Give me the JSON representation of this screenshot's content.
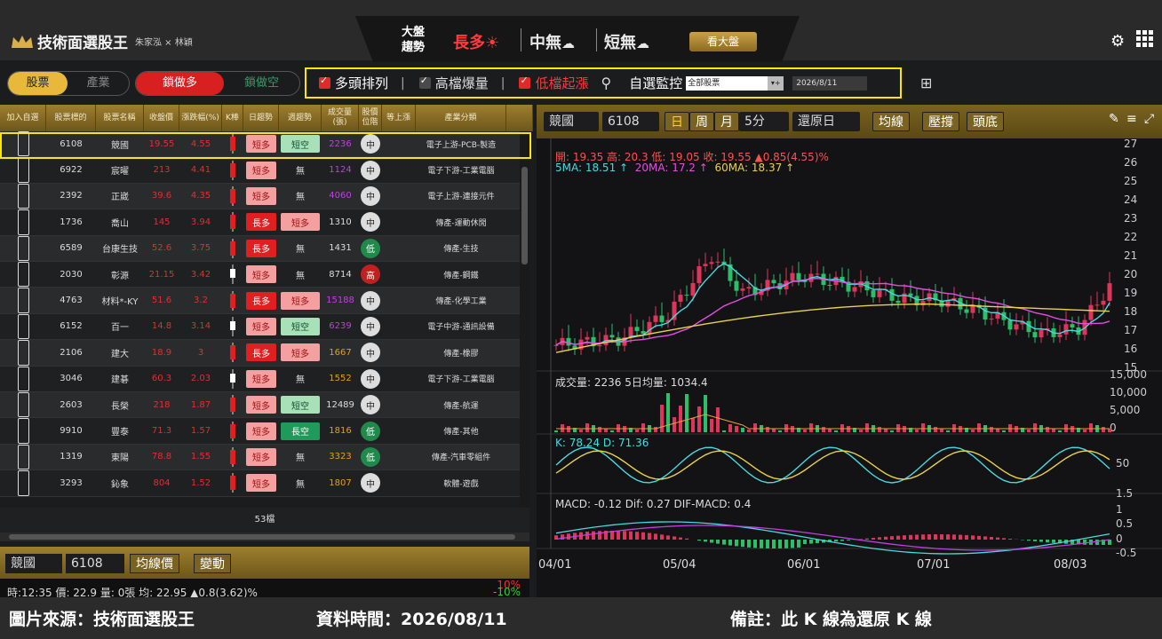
{
  "app": {
    "title": "技術面選股王",
    "authors": "朱家泓 × 林穎"
  },
  "market": {
    "label1": "大盤",
    "label2": "趨勢",
    "long": "長多",
    "mid": "中無",
    "short": "短無",
    "btn": "看大盤"
  },
  "tabs": {
    "stock": "股票",
    "industry": "產業",
    "lock_long": "鎖做多",
    "lock_short": "鎖做空"
  },
  "filters": {
    "f1": "多頭排列",
    "f2": "高檔爆量",
    "f3": "低檔起漲",
    "watch": "自選監控",
    "select": "全部股票",
    "date": "2026/8/11"
  },
  "columns": [
    "加入自選",
    "股票標的",
    "股票名稱",
    "收盤價",
    "漲跌幅(%)",
    "K棒",
    "日趨勢",
    "週趨勢",
    "成交量(張)",
    "股價位階",
    "等上漲",
    "產業分類"
  ],
  "rows": [
    {
      "code": "6108",
      "name": "競國",
      "price": "19.55",
      "chg": "4.55",
      "day": "短多",
      "week": "短空",
      "vol": "2236",
      "pos": "中",
      "ind": "電子上游-PCB-製造",
      "candle": "r"
    },
    {
      "code": "6922",
      "name": "宸曜",
      "price": "213",
      "chg": "4.41",
      "day": "短多",
      "week": "無",
      "vol": "1124",
      "pos": "中",
      "ind": "電子下游-工業電腦",
      "candle": "r"
    },
    {
      "code": "2392",
      "name": "正崴",
      "price": "39.6",
      "chg": "4.35",
      "day": "短多",
      "week": "無",
      "vol": "4060",
      "pos": "中",
      "ind": "電子上游-連接元件",
      "candle": "r"
    },
    {
      "code": "1736",
      "name": "喬山",
      "price": "145",
      "chg": "3.94",
      "day": "長多",
      "week": "短多",
      "vol": "1310",
      "pos": "中",
      "ind": "傳產-運動休閒",
      "candle": "r"
    },
    {
      "code": "6589",
      "name": "台康生技",
      "price": "52.6",
      "chg": "3.75",
      "day": "長多",
      "week": "無",
      "vol": "1431",
      "pos": "低",
      "ind": "傳產-生技",
      "candle": "r"
    },
    {
      "code": "2030",
      "name": "彰源",
      "price": "21.15",
      "chg": "3.42",
      "day": "短多",
      "week": "無",
      "vol": "8714",
      "pos": "高",
      "ind": "傳產-鋼鐵",
      "candle": "w"
    },
    {
      "code": "4763",
      "name": "材料*-KY",
      "price": "51.6",
      "chg": "3.2",
      "day": "長多",
      "week": "短多",
      "vol": "15188",
      "pos": "中",
      "ind": "傳產-化學工業",
      "candle": "r"
    },
    {
      "code": "6152",
      "name": "百一",
      "price": "14.8",
      "chg": "3.14",
      "day": "短多",
      "week": "短空",
      "vol": "6239",
      "pos": "中",
      "ind": "電子中游-通訊設備",
      "candle": "w"
    },
    {
      "code": "2106",
      "name": "建大",
      "price": "18.9",
      "chg": "3",
      "day": "長多",
      "week": "短多",
      "vol": "1667",
      "pos": "中",
      "ind": "傳產-橡膠",
      "candle": "r"
    },
    {
      "code": "3046",
      "name": "建碁",
      "price": "60.3",
      "chg": "2.03",
      "day": "短多",
      "week": "無",
      "vol": "1552",
      "pos": "中",
      "ind": "電子下游-工業電腦",
      "candle": "w"
    },
    {
      "code": "2603",
      "name": "長榮",
      "price": "218",
      "chg": "1.87",
      "day": "短多",
      "week": "短空",
      "vol": "12489",
      "pos": "中",
      "ind": "傳產-航運",
      "candle": "r"
    },
    {
      "code": "9910",
      "name": "豐泰",
      "price": "71.3",
      "chg": "1.57",
      "day": "短多",
      "week": "長空",
      "vol": "1816",
      "pos": "低",
      "ind": "傳產-其他",
      "candle": "r"
    },
    {
      "code": "1319",
      "name": "東陽",
      "price": "78.8",
      "chg": "1.55",
      "day": "短多",
      "week": "無",
      "vol": "3323",
      "pos": "低",
      "ind": "傳產-汽車零組件",
      "candle": "r"
    },
    {
      "code": "3293",
      "name": "鈊象",
      "price": "804",
      "chg": "1.52",
      "day": "短多",
      "week": "無",
      "vol": "1807",
      "pos": "中",
      "ind": "軟體-遊戲",
      "candle": "r"
    }
  ],
  "count": "53檔",
  "chart_toolbar": {
    "name": "競國",
    "code": "6108",
    "d": "日",
    "w": "周",
    "m": "月",
    "min": "5分",
    "restore": "還原日",
    "ma": "均線",
    "sr": "壓撐",
    "top": "頭底"
  },
  "chart_info": {
    "ohlc": "開: 19.35  高: 20.3  低: 19.05  收: 19.55 ▲0.85(4.55)%",
    "ma5": "5MA: 18.51 ↑",
    "ma20": "20MA: 17.2 ↑",
    "ma60": "60MA: 18.37 ↑",
    "vol": "成交量: 2236  5日均量: 1034.4",
    "kd": "K: 78.24  D: 71.36",
    "macd": "MACD: -0.12  Dif: 0.27  DIF-MACD: 0.4"
  },
  "chart_data": {
    "type": "line",
    "price_axis": [
      "27",
      "26",
      "25",
      "24",
      "23",
      "22",
      "21",
      "20",
      "19",
      "18",
      "17",
      "16",
      "15"
    ],
    "vol_axis": [
      "15,000",
      "10,000",
      "5,000",
      "0"
    ],
    "kd_axis": [
      "50"
    ],
    "macd_axis": [
      "1.5",
      "1",
      "0.5",
      "0",
      "-0.5"
    ],
    "dates": [
      "04/01",
      "05/04",
      "06/01",
      "07/01",
      "08/03"
    ]
  },
  "left_bottom": {
    "name": "競國",
    "code": "6108",
    "ma_price": "均線價",
    "change": "變動",
    "tick": "時:12:35 價: 22.9 量: 0張 均: 22.95 ▲0.8(3.62)%",
    "up": "10%",
    "down": "-10%"
  },
  "footer": {
    "source": "圖片來源：技術面選股王",
    "time": "資料時間：2026/08/11",
    "note": "備註：此 K 線為還原 K 線"
  }
}
